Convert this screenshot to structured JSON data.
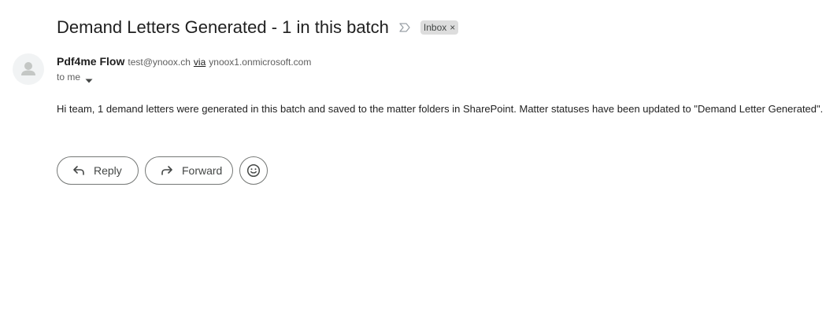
{
  "email": {
    "subject": "Demand Letters Generated - 1 in this batch",
    "importance_icon": "importance-marker-icon",
    "labels": [
      {
        "text": "Inbox",
        "close": "×"
      }
    ],
    "sender": {
      "name": "Pdf4me Flow",
      "email": "test@ynoox.ch",
      "via_label": "via",
      "via_domain": "ynoox1.onmicrosoft.com",
      "avatar_icon": "default-avatar-icon"
    },
    "recipient": {
      "text": "to me",
      "icon": "caret-down-icon"
    },
    "body": "Hi team, 1 demand letters were generated in this batch and saved to the matter folders in SharePoint. Matter statuses have been updated to \"Demand Letter Generated\"."
  },
  "actions": {
    "reply_label": "Reply",
    "reply_icon": "reply-arrow-icon",
    "forward_label": "Forward",
    "forward_icon": "forward-arrow-icon",
    "emoji_icon": "emoji-smiley-icon"
  },
  "colors": {
    "text_primary": "#1f1f1f",
    "text_secondary": "#5e5e5e",
    "chip_bg": "#dddddd",
    "button_border": "#747775",
    "avatar_bg": "#f1f3f4",
    "avatar_fg": "#c4c7c5"
  }
}
